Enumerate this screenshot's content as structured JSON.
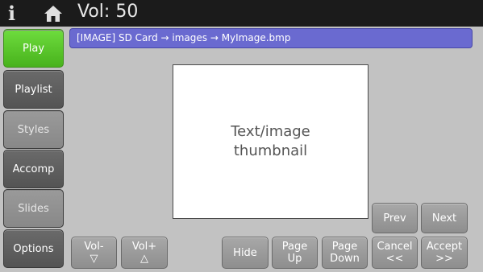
{
  "topbar": {
    "info_icon": "i",
    "home_icon": "home-icon",
    "volume_text": "Vol: 50"
  },
  "sidebar": {
    "items": [
      {
        "label": "Play",
        "state": "active"
      },
      {
        "label": "Playlist",
        "state": "normal"
      },
      {
        "label": "Styles",
        "state": "dim"
      },
      {
        "label": "Accomp",
        "state": "normal"
      },
      {
        "label": "Slides",
        "state": "dim"
      },
      {
        "label": "Options",
        "state": "normal"
      }
    ]
  },
  "path": {
    "text": "[IMAGE] SD Card → images → MyImage.bmp"
  },
  "thumbnail": {
    "text": "Text/image thumbnail"
  },
  "buttons": {
    "vol_down": {
      "top": "Vol-",
      "bottom": "▽"
    },
    "vol_up": {
      "top": "Vol+",
      "bottom": "△"
    },
    "hide": "Hide",
    "page_up": {
      "top": "Page",
      "bottom": "Up"
    },
    "page_down": {
      "top": "Page",
      "bottom": "Down"
    },
    "cancel": {
      "top": "Cancel",
      "bottom": "<<"
    },
    "accept": {
      "top": "Accept",
      "bottom": ">>"
    },
    "prev": "Prev",
    "next": "Next"
  },
  "colors": {
    "active": "#5cc82c",
    "path_bar": "#6a6ad0",
    "background": "#c2c2c2",
    "topbar": "#1b1b1b"
  }
}
